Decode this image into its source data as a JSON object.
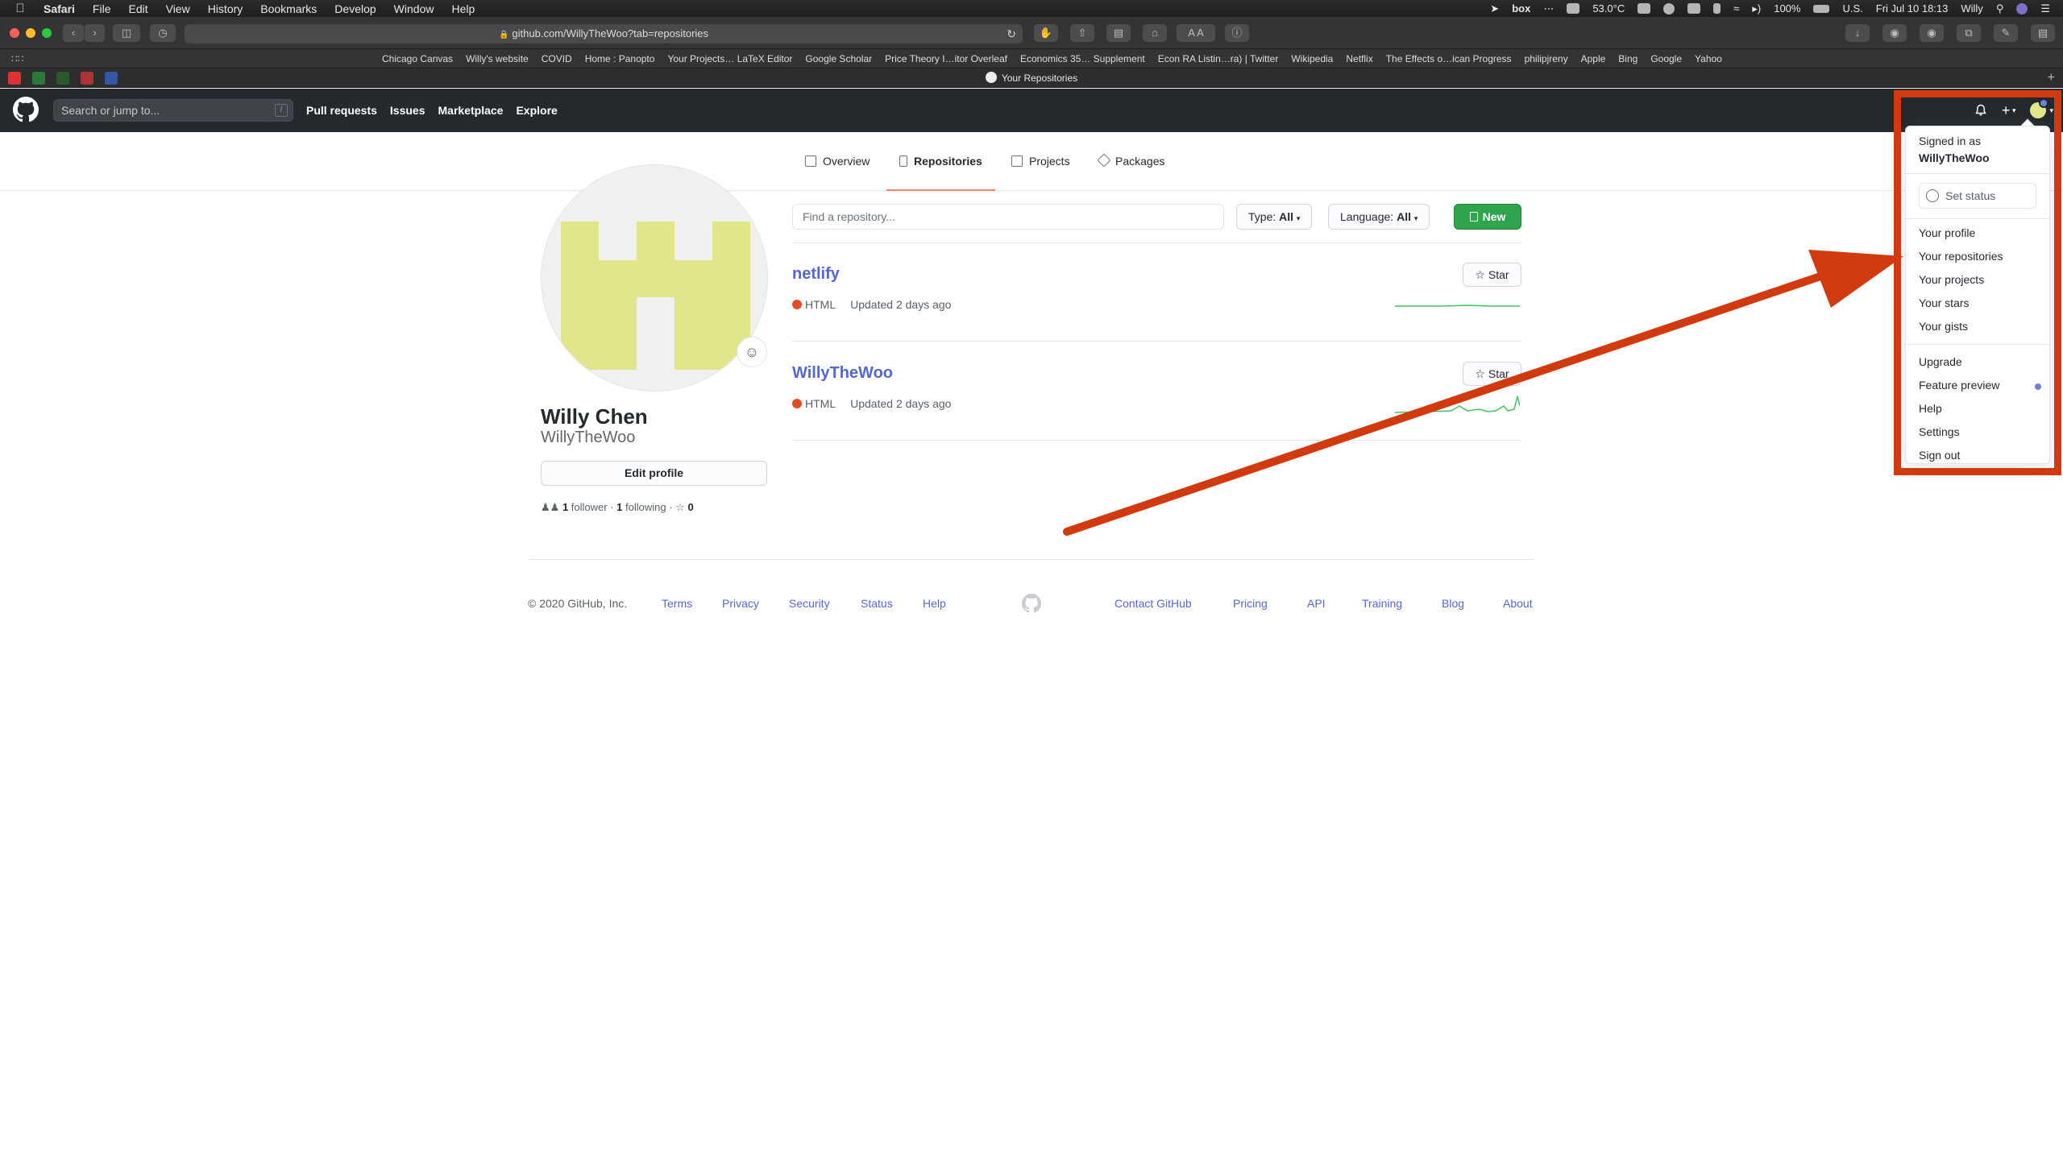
{
  "menubar": {
    "items": [
      "Safari",
      "File",
      "Edit",
      "View",
      "History",
      "Bookmarks",
      "Develop",
      "Window",
      "Help"
    ],
    "status": {
      "box_label": "box",
      "temperature": "53.0°C",
      "battery": "100%",
      "input_source": "U.S.",
      "datetime": "Fri Jul 10  18:13",
      "user": "Willy"
    }
  },
  "browser": {
    "url": "github.com/WillyTheWoo?tab=repositories",
    "tab_title": "Your Repositories",
    "text_size_label": "A A",
    "bookmarks": [
      "Chicago Canvas",
      "Willy's website",
      "COVID",
      "Home : Panopto",
      "Your Projects… LaTeX Editor",
      "Google Scholar",
      "Price Theory I…itor Overleaf",
      "Economics 35… Supplement",
      "Econ RA Listin…ra) | Twitter",
      "Wikipedia",
      "Netflix",
      "The Effects o…ican Progress",
      "philipjreny",
      "Apple",
      "Bing",
      "Google",
      "Yahoo"
    ]
  },
  "github": {
    "search_placeholder": "Search or jump to...",
    "search_shortcut": "/",
    "nav": [
      "Pull requests",
      "Issues",
      "Marketplace",
      "Explore"
    ],
    "profile_tabs": [
      "Overview",
      "Repositories",
      "Projects",
      "Packages"
    ],
    "profile": {
      "name": "Willy Chen",
      "login": "WillyTheWoo",
      "edit_label": "Edit profile",
      "followers_count": "1",
      "followers_label": "follower",
      "following_count": "1",
      "following_label": "following",
      "stars_count": "0"
    },
    "repo_filter": {
      "placeholder": "Find a repository...",
      "type_label": "Type:",
      "type_value": "All",
      "language_label": "Language:",
      "language_value": "All",
      "new_label": "New"
    },
    "repos": [
      {
        "name": "netlify",
        "language": "HTML",
        "updated": "Updated 2 days ago",
        "star_label": "Star"
      },
      {
        "name": "WillyTheWoo",
        "language": "HTML",
        "updated": "Updated 2 days ago",
        "star_label": "Star"
      }
    ],
    "colors": {
      "accent_orange": "#f9826c",
      "link": "#5466d4",
      "green": "#2ea44f",
      "html_lang": "#e34c26",
      "annotation": "#d1390f"
    },
    "footer": {
      "copyright": "© 2020 GitHub, Inc.",
      "links_left": [
        "Terms",
        "Privacy",
        "Security",
        "Status",
        "Help"
      ],
      "links_right": [
        "Contact GitHub",
        "Pricing",
        "API",
        "Training",
        "Blog",
        "About"
      ]
    },
    "user_menu": {
      "signed_in_as": "Signed in as",
      "username": "WillyTheWoo",
      "set_status": "Set status",
      "group1": [
        "Your profile",
        "Your repositories",
        "Your projects",
        "Your stars",
        "Your gists"
      ],
      "group2": [
        "Upgrade",
        "Feature preview",
        "Help",
        "Settings",
        "Sign out"
      ]
    }
  }
}
